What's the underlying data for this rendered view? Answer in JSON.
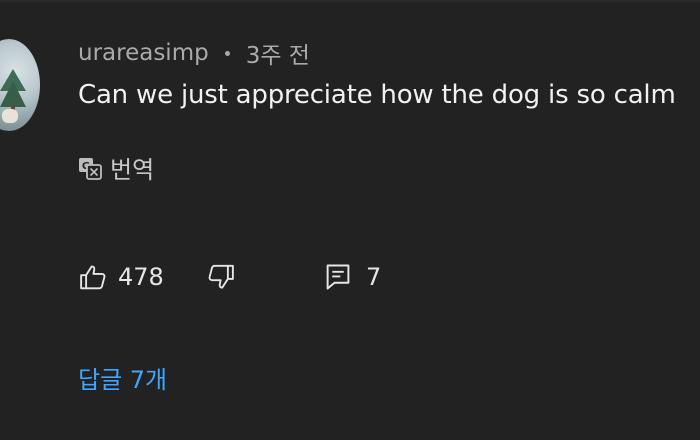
{
  "comment": {
    "author": "urareasimp",
    "time_ago": "3주 전",
    "text": "Can we just appreciate how the dog is so calm",
    "translate_label": "번역",
    "like_count": "478",
    "reply_count": "7",
    "replies_link": "답글 7개"
  },
  "icons": {
    "translate": "translate-icon",
    "like": "thumbs-up-icon",
    "dislike": "thumbs-down-icon",
    "reply": "comment-icon"
  },
  "colors": {
    "background": "#222222",
    "link": "#3ea6ff",
    "text": "#f1f1f1",
    "meta": "#aaaaaa"
  }
}
